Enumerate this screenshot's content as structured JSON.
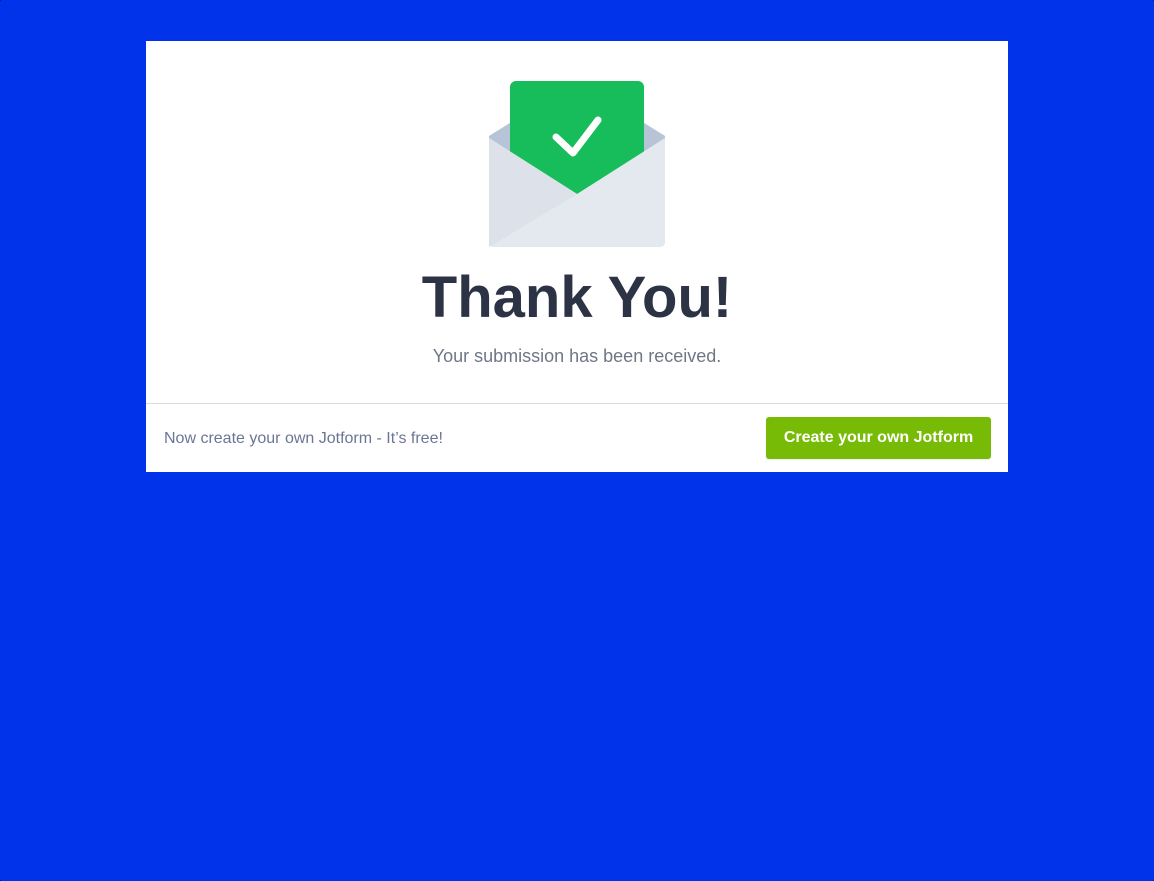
{
  "theme": {
    "background": "#0033ea",
    "card": "#ffffff",
    "accent_green": "#78bb07",
    "envelope_letter": "#18bd5b"
  },
  "illustration": {
    "icon": "envelope-check-icon"
  },
  "confirmation": {
    "title": "Thank You!",
    "message": "Your submission has been received."
  },
  "footer": {
    "promo_text": "Now create your own Jotform - It’s free!",
    "cta_label": "Create your own Jotform"
  }
}
